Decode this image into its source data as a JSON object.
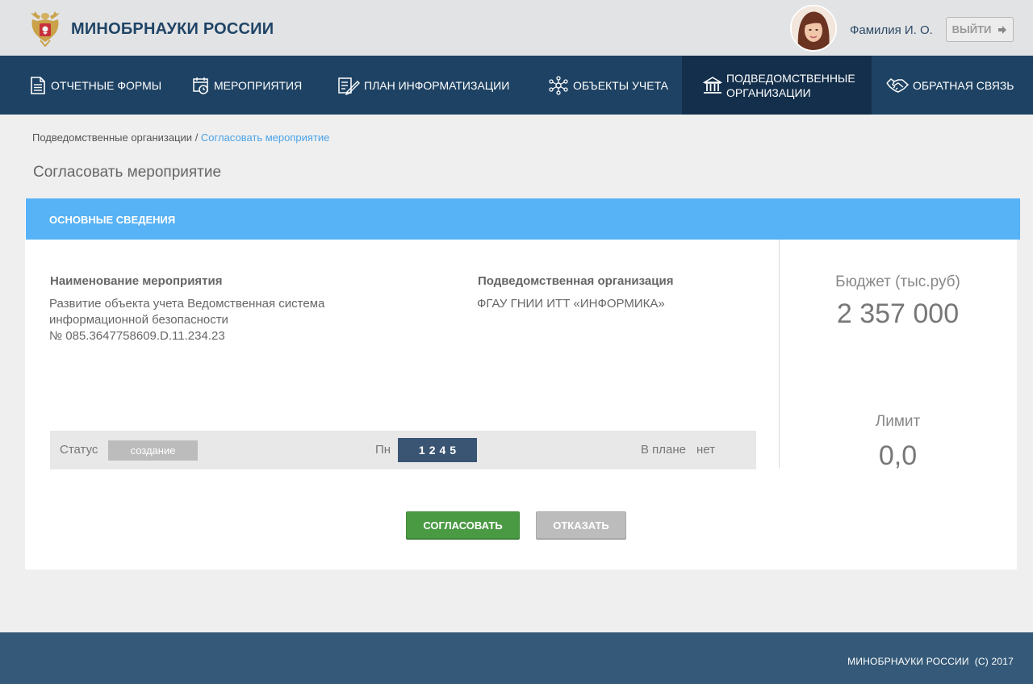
{
  "header": {
    "title": "МИНОБРНАУКИ РОССИИ",
    "user_name": "Фамилия И. О.",
    "logout_label": "ВЫЙТИ"
  },
  "nav": {
    "items": [
      {
        "label": "ОТЧЕТНЫЕ ФОРМЫ",
        "icon": "document-icon"
      },
      {
        "label": "МЕРОПРИЯТИЯ",
        "icon": "calendar-clock-icon"
      },
      {
        "label": "ПЛАН ИНФОРМАТИЗАЦИИ",
        "icon": "plan-edit-icon"
      },
      {
        "label": "ОБЪЕКТЫ УЧЕТА",
        "icon": "network-icon"
      },
      {
        "label_line1": "ПОДВЕДОМСТВЕННЫЕ",
        "label_line2": "ОРГАНИЗАЦИИ",
        "icon": "institution-icon",
        "active": true
      },
      {
        "label": "ОБРАТНАЯ СВЯЗЬ",
        "icon": "handshake-icon"
      }
    ]
  },
  "breadcrumb": {
    "parent": "Подведомственные организации",
    "separator": " / ",
    "current": "Согласовать мероприятие"
  },
  "page_title": "Согласовать мероприятие",
  "card": {
    "header": "ОСНОВНЫЕ СВЕДЕНИЯ",
    "event_name_label": "Наименование мероприятия",
    "event_name_line1": "Развитие объекта учета Ведомственная система",
    "event_name_line2": "информационной безопасности",
    "event_name_line3": "№ 085.3647758609.D.11.234.23",
    "org_label": "Подведомственная организация",
    "org_value": "ФГАУ ГНИИ ИТТ «ИНФОРМИКА»",
    "budget_label": "Бюджет (тыс.руб)",
    "budget_value": "2 357 000",
    "limit_label": "Лимит",
    "limit_value": "0,0",
    "status_label": "Статус",
    "status_value": "создание",
    "pn_label": "Пн",
    "pn_value": "1245",
    "inplan_label": "В плане",
    "inplan_value": "нет",
    "approve_label": "СОГЛАСОВАТЬ",
    "reject_label": "ОТКАЗАТЬ"
  },
  "footer": {
    "text": "МИНОБРНАУКИ РОССИИ  (С) 2017"
  },
  "colors": {
    "header_bg": "#e2e3e5",
    "nav_bg": "#1e4263",
    "nav_active_bg": "#132f4b",
    "card_header_bg": "#57b2f6",
    "approve": "#4a9a44",
    "reject": "#bcbcbc",
    "footer_bg": "#355a79"
  }
}
